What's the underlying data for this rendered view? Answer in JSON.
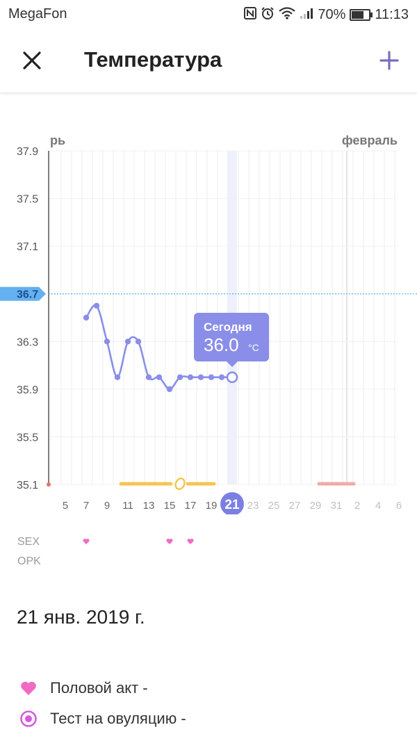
{
  "status_bar": {
    "carrier": "MegaFon",
    "battery_percent": "70%",
    "battery_level": 0.7,
    "time": "11:13",
    "icons": [
      "nfc-icon",
      "alarm-icon",
      "wifi-icon",
      "signal-icon",
      "battery-icon"
    ]
  },
  "header": {
    "title": "Температура",
    "close_icon": "close-icon",
    "add_icon": "plus-icon",
    "accent_color": "#7a6cc0"
  },
  "chart_data": {
    "type": "line",
    "month_labels": [
      "рь",
      "февраль"
    ],
    "y_ticks": [
      "37.9",
      "37.5",
      "37.1",
      "36.7",
      "36.3",
      "35.9",
      "35.5",
      "35.1"
    ],
    "ylim": [
      35.1,
      37.9
    ],
    "highlight_y": "36.7",
    "x_day_labels": [
      "5",
      "7",
      "9",
      "11",
      "13",
      "15",
      "17",
      "19",
      "21",
      "23",
      "25",
      "27",
      "29",
      "31",
      "2",
      "4",
      "6"
    ],
    "today_label": "21",
    "series": [
      {
        "x": [
          7,
          8,
          9,
          10,
          11,
          12,
          13,
          14,
          15,
          16,
          17,
          18,
          19,
          20,
          21
        ],
        "values": [
          36.5,
          36.6,
          36.3,
          36.0,
          36.3,
          36.3,
          36.0,
          36.0,
          35.9,
          36.0,
          36.0,
          36.0,
          36.0,
          36.0,
          36.0
        ]
      }
    ],
    "tooltip": {
      "title": "Сегодня",
      "value": "36.0",
      "unit": "°C"
    },
    "colors": {
      "line": "#8a8ee8",
      "tooltip_bg": "#8a8ee8",
      "today_circle": "#7b7fe3",
      "fertile_band": "#f6c552",
      "period_band": "#f3a9a9",
      "sex_heart": "#f06bc4",
      "highlight_label": "#64b0f0"
    },
    "grid": true
  },
  "markers": {
    "sex_label": "SEX",
    "opk_label": "OPK",
    "sex_days": [
      7,
      15,
      17
    ]
  },
  "details": {
    "date": "21 янв. 2019 г.",
    "items": [
      {
        "icon": "heart-icon",
        "label": "Половой акт -"
      },
      {
        "icon": "ovulation-test-icon",
        "label": "Тест на овуляцию -"
      }
    ]
  }
}
